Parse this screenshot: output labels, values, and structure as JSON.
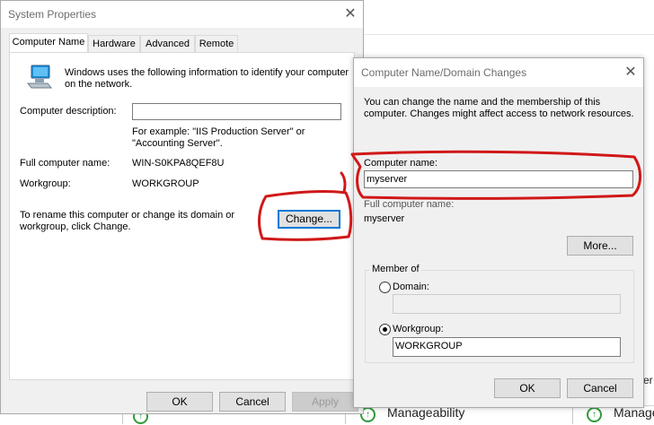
{
  "background": {
    "manageability_label": "Manageability",
    "manageability_label_short": "Manage"
  },
  "system_properties": {
    "title": "System Properties",
    "tabs": [
      {
        "label": "Computer Name"
      },
      {
        "label": "Hardware"
      },
      {
        "label": "Advanced"
      },
      {
        "label": "Remote"
      }
    ],
    "intro_line1": "Windows uses the following information to identify your computer",
    "intro_line2": "on the network.",
    "description_label": "Computer description:",
    "description_value": "",
    "example_line1": "For example: \"IIS Production Server\" or",
    "example_line2": "\"Accounting Server\".",
    "full_name_label": "Full computer name:",
    "full_name_value": "WIN-S0KPA8QEF8U",
    "workgroup_label": "Workgroup:",
    "workgroup_value": "WORKGROUP",
    "rename_line1": "To rename this computer or change its domain or",
    "rename_line2": "workgroup, click Change.",
    "change_button": "Change...",
    "ok_button": "OK",
    "cancel_button": "Cancel",
    "apply_button": "Apply"
  },
  "name_changes": {
    "title": "Computer Name/Domain Changes",
    "intro_line1": "You can change the name and the membership of this",
    "intro_line2": "computer. Changes might affect access to network resources.",
    "computer_name_label": "Computer name:",
    "computer_name_value": "myserver",
    "full_name_label": "Full computer name:",
    "full_name_value": "myserver",
    "more_button": "More...",
    "member_of_label": "Member of",
    "domain_label": "Domain:",
    "domain_value": "",
    "workgroup_label": "Workgroup:",
    "workgroup_value": "WORKGROUP",
    "selected_membership": "Workgroup",
    "ok_button": "OK",
    "cancel_button": "Cancel"
  },
  "annotation": {
    "color": "#d01818"
  }
}
